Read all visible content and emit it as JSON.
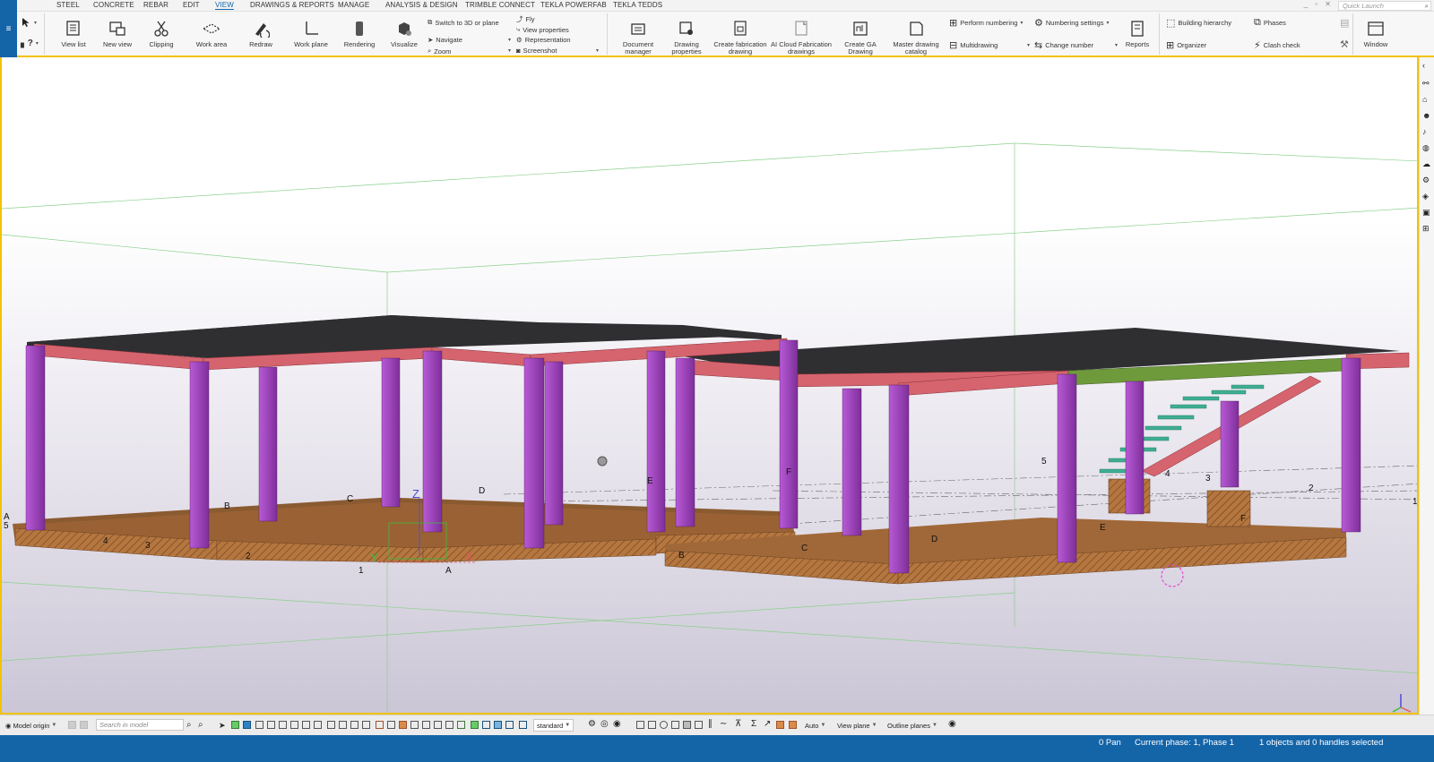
{
  "menu": {
    "tabs": [
      "STEEL",
      "CONCRETE",
      "REBAR",
      "EDIT",
      "VIEW",
      "DRAWINGS & REPORTS",
      "MANAGE",
      "ANALYSIS & DESIGN",
      "TRIMBLE CONNECT",
      "TEKLA POWERFAB",
      "TEKLA TEDDS"
    ],
    "active_tab": "VIEW",
    "quick_launch_placeholder": "Quick Launch"
  },
  "ribbon": {
    "view_list": "View list",
    "new_view": "New view",
    "clipping": "Clipping",
    "work_area": "Work area",
    "redraw": "Redraw",
    "work_plane": "Work plane",
    "rendering": "Rendering",
    "visualize": "Visualize",
    "switch_3d": "Switch to 3D or plane",
    "navigate": "Navigate",
    "zoom": "Zoom",
    "fly": "Fly",
    "view_properties": "View properties",
    "representation": "Representation",
    "screenshot": "Screenshot",
    "document_manager": [
      "Document",
      "manager"
    ],
    "drawing_properties": [
      "Drawing",
      "properties"
    ],
    "create_fabrication": [
      "Create fabrication",
      "drawing"
    ],
    "ai_cloud": [
      "AI Cloud Fabrication",
      "drawings"
    ],
    "create_ga": [
      "Create GA",
      "Drawing"
    ],
    "master_catalog": [
      "Master drawing",
      "catalog"
    ],
    "perform_numbering": "Perform numbering",
    "numbering_settings": "Numbering settings",
    "multidrawing": "Multidrawing",
    "change_number": "Change number",
    "reports": "Reports",
    "building_hierarchy": "Building hierarchy",
    "organizer": "Organizer",
    "phases": "Phases",
    "clash_check": "Clash check",
    "window": "Window"
  },
  "viewport": {
    "grid_labels_left": [
      "A",
      "B",
      "C",
      "D",
      "E",
      "F",
      "1",
      "2",
      "3",
      "4",
      "5"
    ],
    "grid_labels_right": [
      "D",
      "E",
      "F",
      "5",
      "4",
      "3",
      "2",
      "1",
      "B",
      "C"
    ],
    "axis": {
      "x": "X",
      "y": "Y",
      "z": "Z"
    }
  },
  "bottombar": {
    "model_origin": "Model origin",
    "search_placeholder": "Search in model",
    "standard": "standard",
    "auto": "Auto",
    "view_plane": "View plane",
    "outline_planes": "Outline planes"
  },
  "status": {
    "mode": "0  Pan",
    "phase": "Current phase: 1, Phase 1",
    "selection": "1 objects and 0 handles selected"
  },
  "colors": {
    "accent": "#1464a8",
    "column": "#9c44b8",
    "beam": "#d5646e",
    "slab": "#2f2f31",
    "footing": "#b5763f",
    "stair": "#3fae93",
    "beam_green": "#6f9a3c"
  }
}
